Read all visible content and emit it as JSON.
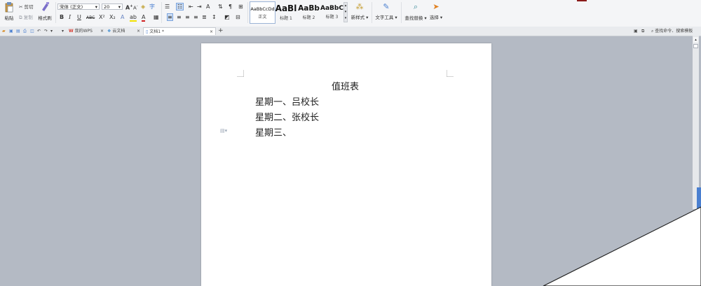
{
  "clipboard": {
    "paste": "粘贴",
    "cut": "剪切",
    "copy": "复制",
    "format_painter": "格式刷"
  },
  "font": {
    "name": "宋体 (正文)",
    "size": "20"
  },
  "format": {
    "bold": "B",
    "italic": "I",
    "underline": "U",
    "strikethrough": "ABC",
    "superscript": "X²",
    "subscript": "X₂"
  },
  "styles": [
    {
      "sample": "AaBbCcDd",
      "name": "正文"
    },
    {
      "sample": "AaBl",
      "name": "标题 1"
    },
    {
      "sample": "AaBb",
      "name": "标题 2"
    },
    {
      "sample": "AaBbC",
      "name": "标题 3"
    }
  ],
  "ribbon_buttons": {
    "new_style": "新样式",
    "text_tools": "文字工具",
    "find_replace": "查找替换",
    "select": "选择"
  },
  "tabs": [
    {
      "label": "我的WPS"
    },
    {
      "label": "云文档"
    },
    {
      "label": "文档1 *"
    }
  ],
  "search": {
    "placeholder": "查找命令、搜索模板"
  },
  "document": {
    "title": "值班表",
    "lines": [
      "星期一、吕校长",
      "星期二、张校长",
      "星期三、"
    ]
  },
  "colors": {
    "ribbon_bg": "#f4f5f7",
    "workspace_bg": "#b4bac4",
    "page_bg": "#ffffff",
    "wps_red": "#d63a2f",
    "accent_blue": "#4a7fd0"
  }
}
